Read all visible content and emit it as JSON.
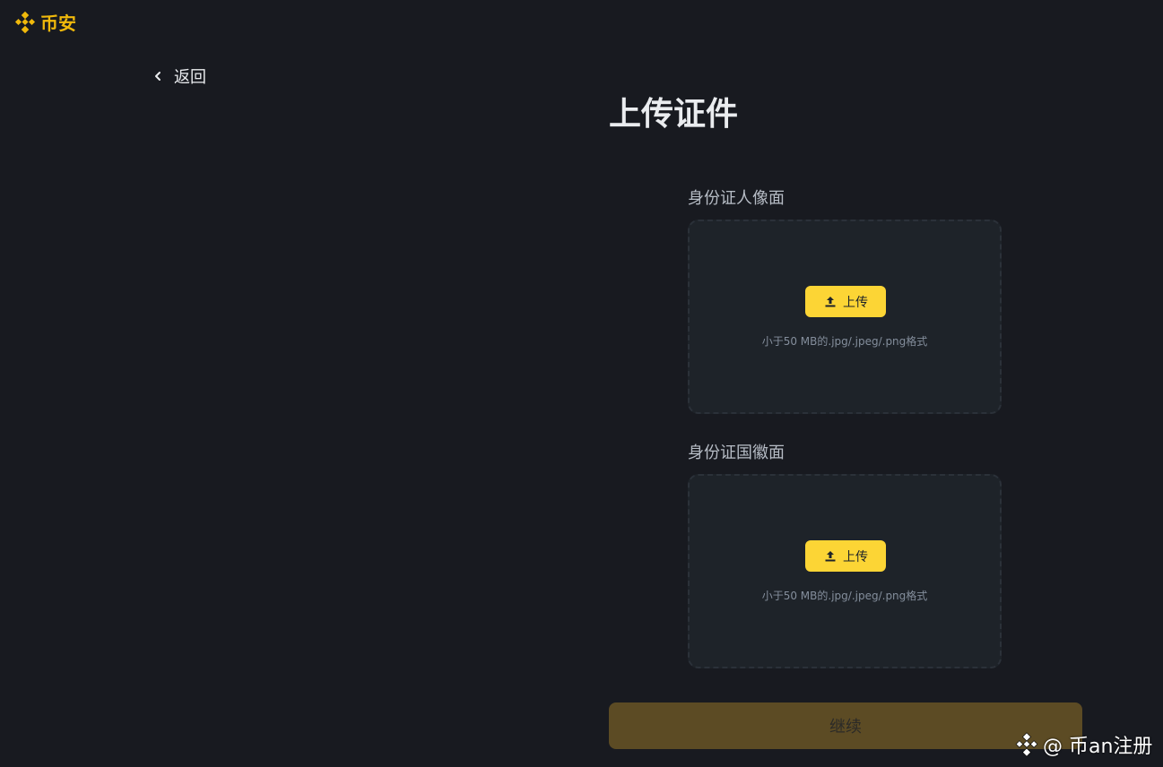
{
  "header": {
    "logo_text": "币安",
    "brand_color": "#f0b90b"
  },
  "nav": {
    "back_label": "返回",
    "back_icon": "chevron-left-icon"
  },
  "page": {
    "title": "上传证件"
  },
  "uploads": [
    {
      "label": "身份证人像面",
      "button_label": "上传",
      "button_icon": "upload-icon",
      "hint": "小于50 MB的.jpg/.jpeg/.png格式"
    },
    {
      "label": "身份证国徽面",
      "button_label": "上传",
      "button_icon": "upload-icon",
      "hint": "小于50 MB的.jpg/.jpeg/.png格式"
    }
  ],
  "actions": {
    "continue_label": "继续",
    "accent_color": "#fcd535"
  },
  "watermark": {
    "text": "@ 币an注册"
  }
}
